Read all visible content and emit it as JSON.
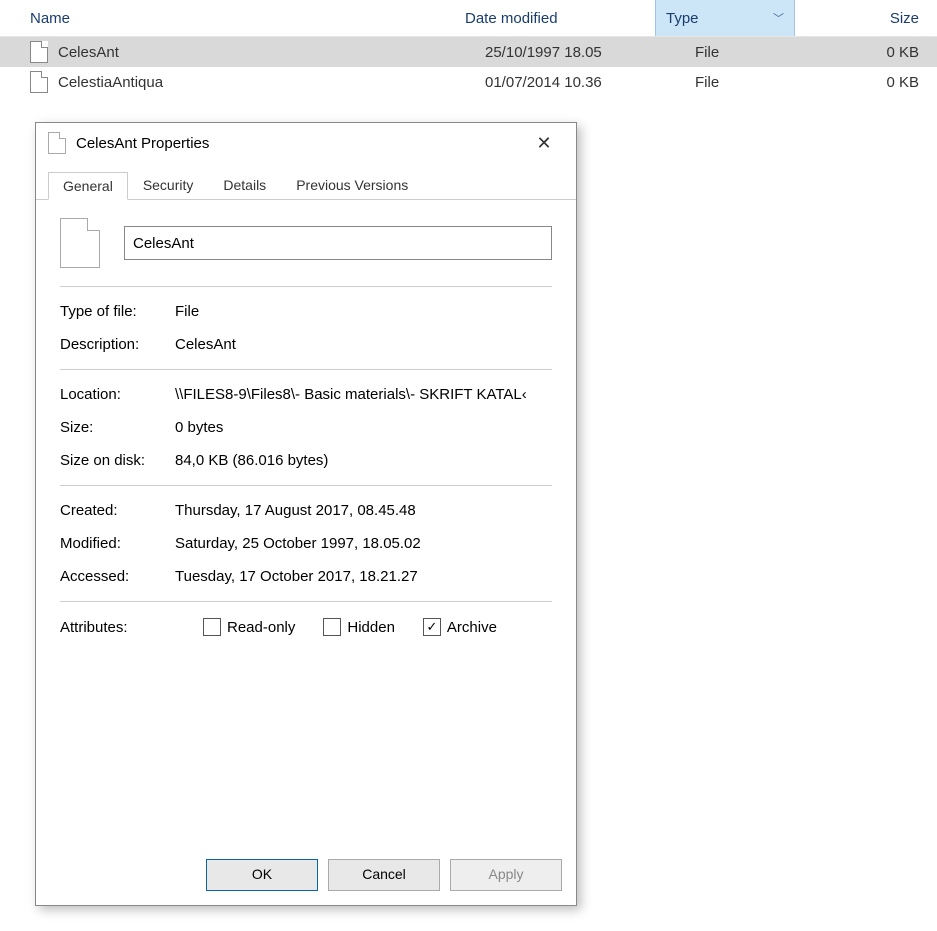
{
  "columns": {
    "name": "Name",
    "date": "Date modified",
    "type": "Type",
    "size": "Size"
  },
  "files": [
    {
      "name": "CelesAnt",
      "date": "25/10/1997 18.05",
      "type": "File",
      "size": "0 KB",
      "selected": true
    },
    {
      "name": "CelestiaAntiqua",
      "date": "01/07/2014 10.36",
      "type": "File",
      "size": "0 KB",
      "selected": false
    }
  ],
  "dialog": {
    "title": "CelesAnt Properties",
    "tabs": {
      "general": "General",
      "security": "Security",
      "details": "Details",
      "previous": "Previous Versions"
    },
    "filename": "CelesAnt",
    "labels": {
      "type": "Type of file:",
      "desc": "Description:",
      "loc": "Location:",
      "size": "Size:",
      "disk": "Size on disk:",
      "created": "Created:",
      "modified": "Modified:",
      "accessed": "Accessed:",
      "attrs": "Attributes:",
      "readonly": "Read-only",
      "hidden": "Hidden",
      "archive": "Archive"
    },
    "values": {
      "type": "File",
      "desc": "CelesAnt",
      "loc": "\\\\FILES8-9\\Files8\\- Basic materials\\- SKRIFT KATAL‹",
      "size": "0 bytes",
      "disk": "84,0 KB (86.016 bytes)",
      "created": "Thursday, 17 August 2017, 08.45.48",
      "modified": "Saturday, 25 October 1997, 18.05.02",
      "accessed": "Tuesday, 17 October 2017, 18.21.27"
    },
    "attrs": {
      "readonly": false,
      "hidden": false,
      "archive": true
    },
    "buttons": {
      "ok": "OK",
      "cancel": "Cancel",
      "apply": "Apply"
    }
  }
}
